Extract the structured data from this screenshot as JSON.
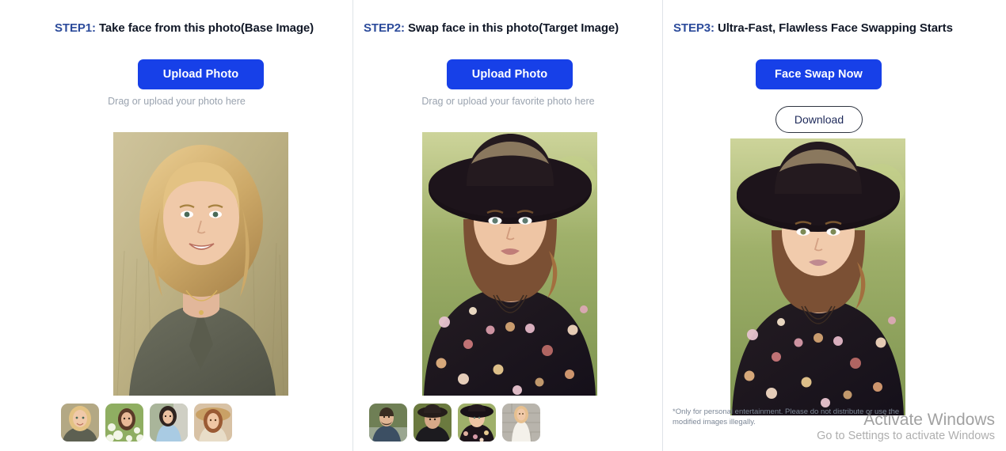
{
  "theme": {
    "page_bg": "#ffffff",
    "primary_button_bg": "#1740e8",
    "primary_button_text": "#ffffff",
    "step_label_color": "#2c4b9b",
    "heading_color": "#111827",
    "hint_color": "#9aa3af",
    "divider_color": "#dfe3e8",
    "outline_button_border": "#2e3440",
    "outline_button_text": "#1e2a5a",
    "disclaimer_color": "#7c8796",
    "watermark_color": "#8c8c8c"
  },
  "columns": [
    {
      "step_label": "STEP1:",
      "step_title": "Take face from this photo(Base Image)",
      "upload_button": "Upload Photo",
      "hint": "Drag or upload your photo here",
      "photo_alt": "blonde woman smiling in grass field wearing olive shirt",
      "thumbnails": [
        "blonde-woman-olive-shirt",
        "brunette-woman-white-flowers",
        "dark-hair-woman-blue-dress",
        "redhead-woman-straw-hat"
      ]
    },
    {
      "step_label": "STEP2:",
      "step_title": "Swap face in this photo(Target Image)",
      "upload_button": "Upload Photo",
      "hint": "Drag or upload your favorite photo here",
      "photo_alt": "woman in black floppy hat and floral dress outdoors",
      "thumbnails": [
        "bearded-man-denim-jacket",
        "woman-dark-hat-portrait",
        "woman-black-hat-floral-dress",
        "blonde-woman-white-dress-wall"
      ]
    },
    {
      "step_label": "STEP3:",
      "step_title": "Ultra-Fast, Flawless Face Swapping Starts",
      "swap_button": "Face Swap Now",
      "download_button": "Download",
      "photo_alt": "face-swapped result: woman in black floppy hat and floral dress",
      "disclaimer": "*Only for personal entertainment. Please do not distribute or use the modified images illegally."
    }
  ],
  "watermark": {
    "title": "Activate Windows",
    "subtitle": "Go to Settings to activate Windows"
  }
}
